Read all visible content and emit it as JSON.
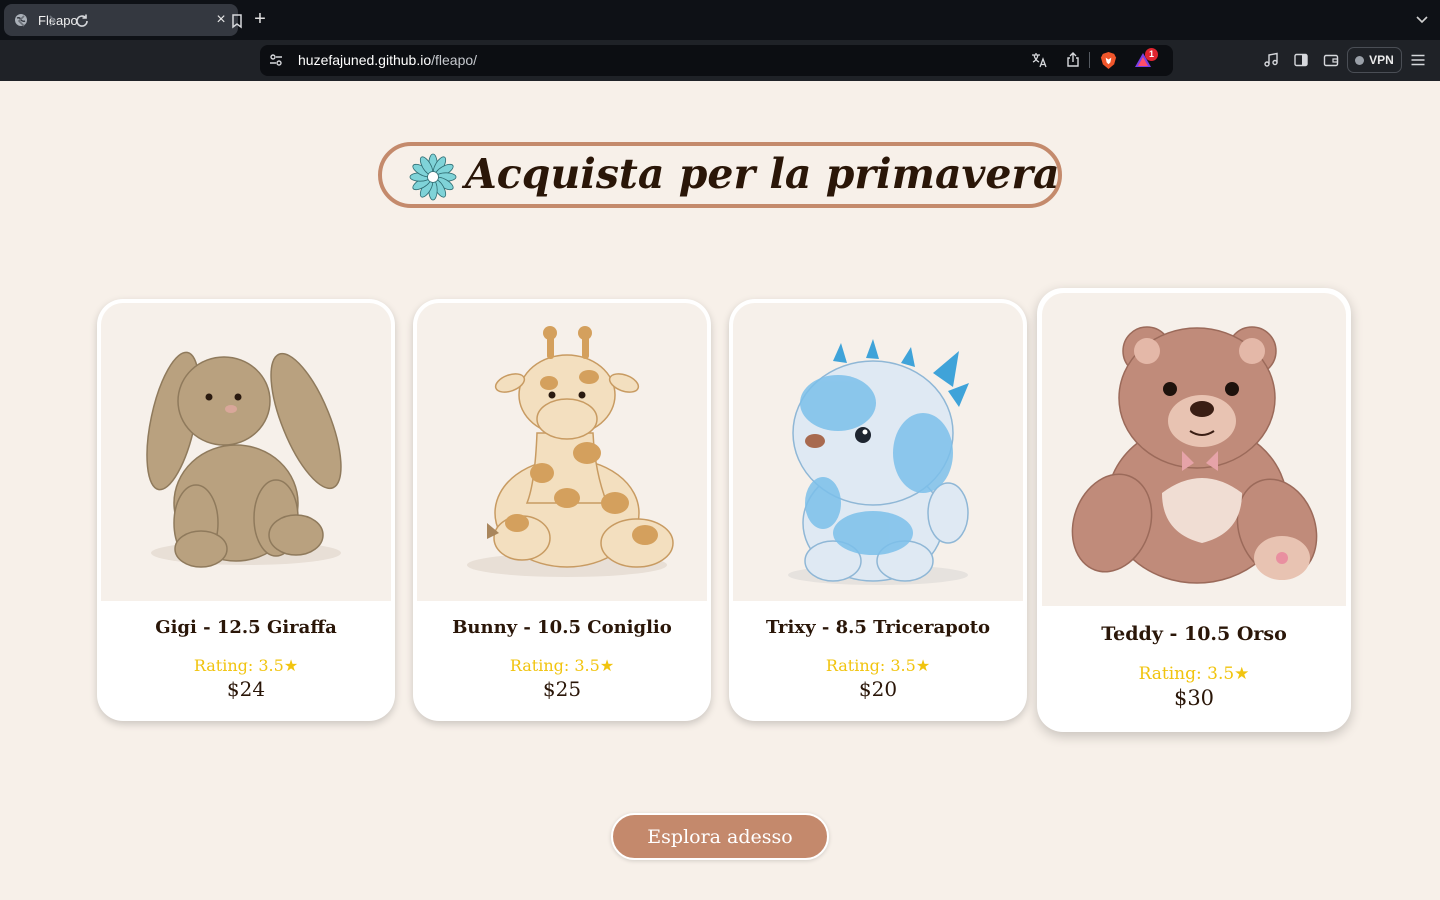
{
  "browser": {
    "tab_title": "Fleapo",
    "url_host": "huzefajuned.github.io",
    "url_path": "/fleapo/",
    "notification_count": "1",
    "vpn_label": "VPN"
  },
  "page": {
    "headline": "Acquista per la primavera",
    "cta_label": "Esplora adesso"
  },
  "products": [
    {
      "name": "Gigi - 12.5 Giraffa",
      "rating": "Rating: 3.5★",
      "price": "$24",
      "image": "bunny plush"
    },
    {
      "name": "Bunny - 10.5 Coniglio",
      "rating": "Rating: 3.5★",
      "price": "$25",
      "image": "giraffe plush"
    },
    {
      "name": "Trixy - 8.5 Tricerapoto",
      "rating": "Rating: 3.5★",
      "price": "$20",
      "image": "dragon plush"
    },
    {
      "name": "Teddy - 10.5 Orso",
      "rating": "Rating: 3.5★",
      "price": "$30",
      "image": "teddy bear plush"
    }
  ],
  "colors": {
    "page_bg": "#f7f0e9",
    "accent": "#c4896c",
    "rating": "#f1c40f",
    "text_dark": "#2a1608"
  }
}
